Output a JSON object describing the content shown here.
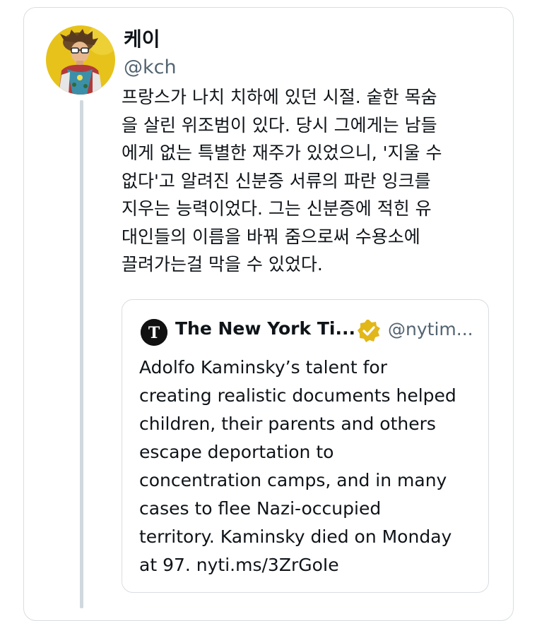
{
  "tweet": {
    "display_name": "케이",
    "handle": "@kch",
    "text": "프랑스가 나치 치하에 있던 시절. 숱한 목숨\n을 살린 위조범이 있다. 당시 그에게는 남들\n에게 없는 특별한 재주가 있었으니, '지울 수\n없다'고 알려진 신분증 서류의 파란 잉크를\n지우는 능력이었다. 그는 신분증에 적힌 유\n대인들의 이름을 바꿔 줌으로써 수용소에\n끌려가는걸 막을 수 있었다."
  },
  "quoted": {
    "display_name": "The New York Ti...",
    "handle": "@nytim...",
    "text": "Adolfo Kaminsky’s talent for\ncreating realistic documents helped\nchildren, their parents and others\nescape deportation to\nconcentration camps, and in many\ncases to flee Nazi-occupied\nterritory. Kaminsky died on Monday\nat 97. nyti.ms/3ZrGoIe"
  },
  "colors": {
    "verified_badge": "#e2b719",
    "avatar_bg": "#e7c21a",
    "handle_gray": "#536471",
    "border": "#d9dde1"
  },
  "icons": {
    "verified": "verified-gold-badge",
    "nyt_logo": "nyt-logo"
  }
}
